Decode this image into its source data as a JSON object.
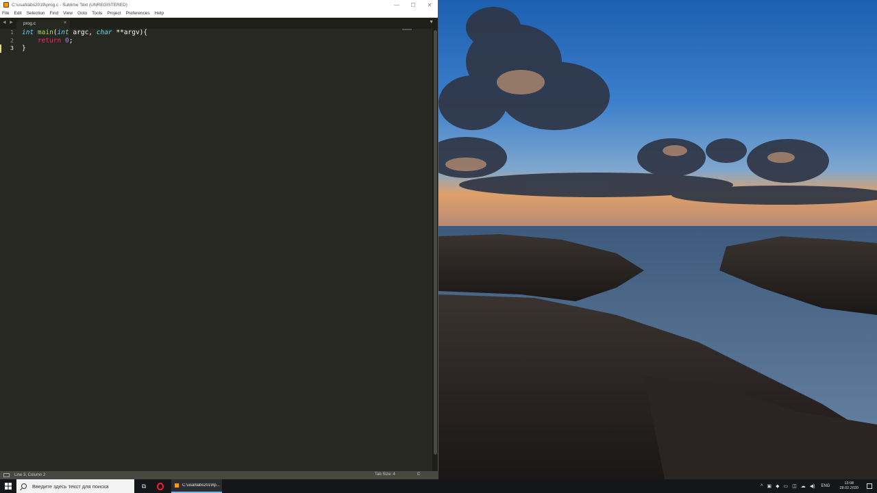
{
  "window": {
    "title": "C:\\usal\\labs2019\\prog.c - Sublime Text (UNREGISTERED)",
    "controls": {
      "minimize": "—",
      "maximize": "☐",
      "close": "✕"
    }
  },
  "menu": [
    "File",
    "Edit",
    "Selection",
    "Find",
    "View",
    "Goto",
    "Tools",
    "Project",
    "Preferences",
    "Help"
  ],
  "tabs": {
    "arrows": "◀ ▶",
    "active": "prog.c",
    "close": "×",
    "dropdown": "▼"
  },
  "editor": {
    "lines": [
      {
        "num": "1",
        "tokens": [
          {
            "t": "int",
            "c": "kw-type"
          },
          {
            "t": " "
          },
          {
            "t": "main",
            "c": "fn"
          },
          {
            "t": "("
          },
          {
            "t": "int",
            "c": "kw-type"
          },
          {
            "t": " argc, "
          },
          {
            "t": "char",
            "c": "kw-type"
          },
          {
            "t": " **argv){"
          }
        ]
      },
      {
        "num": "2",
        "tokens": [
          {
            "t": "    "
          },
          {
            "t": "return",
            "c": "kw"
          },
          {
            "t": " "
          },
          {
            "t": "0",
            "c": "num"
          },
          {
            "t": ";"
          }
        ]
      },
      {
        "num": "3",
        "tokens": [
          {
            "t": "}"
          }
        ]
      }
    ]
  },
  "status": {
    "position": "Line 3, Column 2",
    "tab_size": "Tab Size: 4",
    "syntax": "C"
  },
  "taskbar": {
    "search_placeholder": "Введите здесь текст для поиска",
    "app_label": "C:\\usal\\labs2019\\p...",
    "lang": "ENG",
    "time": "13:08",
    "date": "28.02.2020"
  }
}
